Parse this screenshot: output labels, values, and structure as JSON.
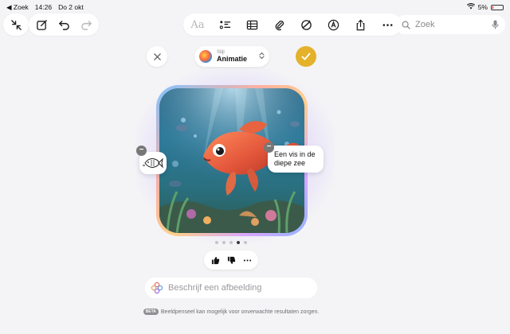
{
  "status_bar": {
    "back_label": "◀ Zoek",
    "time": "14:26",
    "date": "Do 2 okt",
    "battery": "5%"
  },
  "toolbar": {
    "format_label": "Aa"
  },
  "search": {
    "placeholder": "Zoek"
  },
  "playground": {
    "style_caption": "Stijl",
    "style_value": "Animatie",
    "concept_chip": "Een vis in de diepe zee",
    "page_count": 5,
    "active_page": 4,
    "prompt_placeholder": "Beschrijf een afbeelding",
    "beta_badge": "BETA",
    "disclaimer": "Beeldpenseel kan mogelijk voor onverwachte resultaten zorgen."
  },
  "colors": {
    "accent": "#e4b12a",
    "background": "#f4f4f6"
  },
  "icons": {
    "collapse": "collapse-arrows-icon",
    "compose": "compose-icon",
    "undo": "undo-icon",
    "redo": "redo-icon",
    "checklist": "checklist-icon",
    "table": "table-icon",
    "attachment": "paperclip-icon",
    "image_playground": "image-playground-icon",
    "markup": "pen-markup-icon",
    "share": "share-icon",
    "more": "ellipsis-icon",
    "search": "magnifier-icon",
    "dictation": "microphone-icon"
  }
}
